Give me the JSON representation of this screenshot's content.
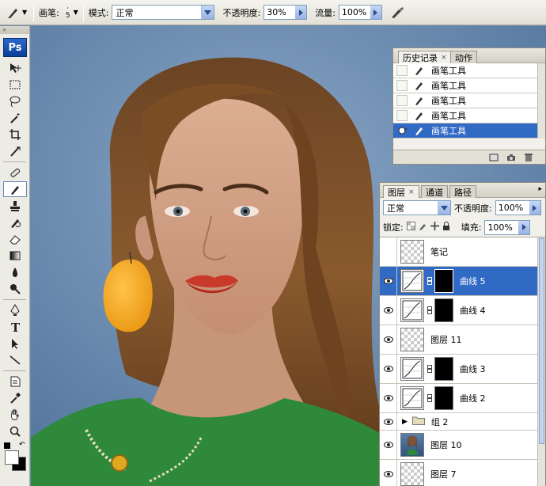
{
  "options_bar": {
    "brush_label": "画笔:",
    "brush_size": "5",
    "mode_label": "模式:",
    "mode_value": "正常",
    "opacity_label": "不透明度:",
    "opacity_value": "30%",
    "flow_label": "流量:",
    "flow_value": "100%"
  },
  "tools": {
    "logo": "Ps"
  },
  "history": {
    "tabs": [
      {
        "label": "历史记录",
        "active": true
      },
      {
        "label": "动作",
        "active": false
      }
    ],
    "items": [
      "画笔工具",
      "画笔工具",
      "画笔工具",
      "画笔工具",
      "画笔工具"
    ],
    "selected_index": 4
  },
  "layers": {
    "tabs": [
      {
        "label": "图层"
      },
      {
        "label": "通道"
      },
      {
        "label": "路径"
      }
    ],
    "blend_mode": "正常",
    "opacity_label": "不透明度:",
    "opacity_value": "100%",
    "lock_label": "锁定:",
    "fill_label": "填充:",
    "fill_value": "100%",
    "items": [
      {
        "name": "笔记",
        "kind": "pixel",
        "visible": false
      },
      {
        "name": "曲线 5",
        "kind": "curves",
        "visible": true,
        "selected": true
      },
      {
        "name": "曲线 4",
        "kind": "curves",
        "visible": true
      },
      {
        "name": "图层 11",
        "kind": "pixel",
        "visible": true
      },
      {
        "name": "曲线 3",
        "kind": "curves",
        "visible": true
      },
      {
        "name": "曲线 2",
        "kind": "curves",
        "visible": true
      },
      {
        "name": "组 2",
        "kind": "group",
        "visible": true
      },
      {
        "name": "图层 10",
        "kind": "photo",
        "visible": true
      },
      {
        "name": "图层 7",
        "kind": "pixel",
        "visible": true
      }
    ]
  },
  "colors": {
    "selection": "#316ac5",
    "panel_bg": "#f1f0ea",
    "canvas_bg": "#6e8db0",
    "earring": "#f5a623"
  }
}
